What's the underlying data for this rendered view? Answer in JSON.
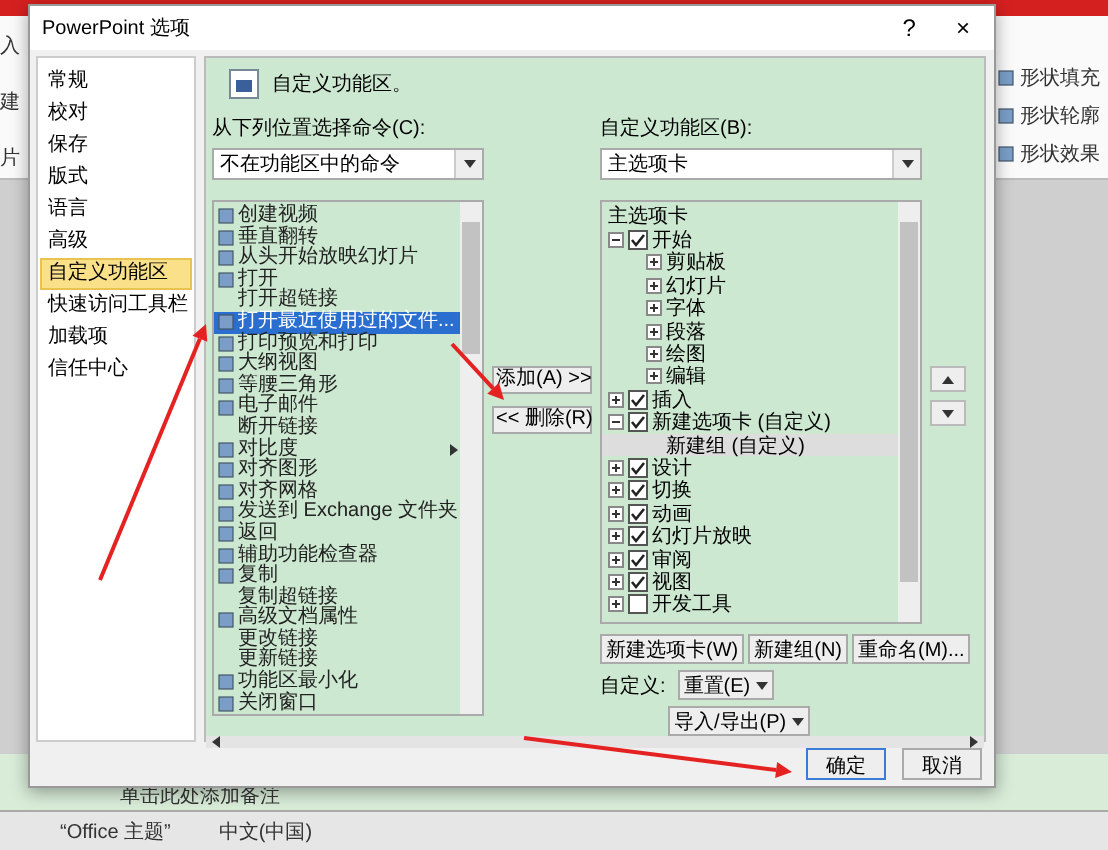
{
  "app": {
    "ribbon_left": [
      "入",
      "建",
      "片"
    ],
    "ribbon_right": [
      "形状填充",
      "形状轮廓",
      "形状效果"
    ],
    "notes": "单击此处添加备注",
    "status": [
      "“Office 主题”",
      "中文(中国)"
    ]
  },
  "dialog": {
    "title": "PowerPoint 选项",
    "help": "?",
    "close": "×",
    "nav": [
      {
        "label": "常规",
        "selected": false
      },
      {
        "label": "校对",
        "selected": false
      },
      {
        "label": "保存",
        "selected": false
      },
      {
        "label": "版式",
        "selected": false
      },
      {
        "label": "语言",
        "selected": false
      },
      {
        "label": "高级",
        "selected": false
      },
      {
        "label": "自定义功能区",
        "selected": true
      },
      {
        "label": "快速访问工具栏",
        "selected": false
      },
      {
        "label": "加载项",
        "selected": false
      },
      {
        "label": "信任中心",
        "selected": false
      }
    ],
    "heading": "自定义功能区。",
    "source_label": "从下列位置选择命令(C):",
    "source_value": "不在功能区中的命令",
    "target_label": "自定义功能区(B):",
    "target_value": "主选项卡",
    "commands": [
      {
        "label": "创建视频",
        "selected": false,
        "has_icon": true,
        "submenu": false
      },
      {
        "label": "垂直翻转",
        "selected": false,
        "has_icon": true,
        "submenu": false
      },
      {
        "label": "从头开始放映幻灯片",
        "selected": false,
        "has_icon": true,
        "submenu": false
      },
      {
        "label": "打开",
        "selected": false,
        "has_icon": true,
        "submenu": false
      },
      {
        "label": "打开超链接",
        "selected": false,
        "has_icon": false,
        "submenu": false
      },
      {
        "label": "打开最近使用过的文件...",
        "selected": true,
        "has_icon": true,
        "submenu": false
      },
      {
        "label": "打印预览和打印",
        "selected": false,
        "has_icon": true,
        "submenu": false
      },
      {
        "label": "大纲视图",
        "selected": false,
        "has_icon": true,
        "submenu": false
      },
      {
        "label": "等腰三角形",
        "selected": false,
        "has_icon": true,
        "submenu": false
      },
      {
        "label": "电子邮件",
        "selected": false,
        "has_icon": true,
        "submenu": false
      },
      {
        "label": "断开链接",
        "selected": false,
        "has_icon": false,
        "submenu": false
      },
      {
        "label": "对比度",
        "selected": false,
        "has_icon": true,
        "submenu": true
      },
      {
        "label": "对齐图形",
        "selected": false,
        "has_icon": true,
        "submenu": false
      },
      {
        "label": "对齐网格",
        "selected": false,
        "has_icon": true,
        "submenu": false
      },
      {
        "label": "发送到 Exchange 文件夹",
        "selected": false,
        "has_icon": true,
        "submenu": false
      },
      {
        "label": "返回",
        "selected": false,
        "has_icon": true,
        "submenu": false
      },
      {
        "label": "辅助功能检查器",
        "selected": false,
        "has_icon": true,
        "submenu": false
      },
      {
        "label": "复制",
        "selected": false,
        "has_icon": true,
        "submenu": false
      },
      {
        "label": "复制超链接",
        "selected": false,
        "has_icon": false,
        "submenu": false
      },
      {
        "label": "高级文档属性",
        "selected": false,
        "has_icon": true,
        "submenu": false
      },
      {
        "label": "更改链接",
        "selected": false,
        "has_icon": false,
        "submenu": false
      },
      {
        "label": "更新链接",
        "selected": false,
        "has_icon": false,
        "submenu": false
      },
      {
        "label": "功能区最小化",
        "selected": false,
        "has_icon": true,
        "submenu": false
      },
      {
        "label": "关闭窗口",
        "selected": false,
        "has_icon": true,
        "submenu": false
      }
    ],
    "add_button": "添加(A) >>",
    "remove_button": "<< 删除(R)",
    "tree_header": "主选项卡",
    "tree": [
      {
        "kind": "tab",
        "label": "开始",
        "checked": true,
        "expanded": true,
        "selected": false,
        "children": [
          {
            "kind": "group",
            "label": "剪贴板",
            "selected": false
          },
          {
            "kind": "group",
            "label": "幻灯片",
            "selected": false
          },
          {
            "kind": "group",
            "label": "字体",
            "selected": false
          },
          {
            "kind": "group",
            "label": "段落",
            "selected": false
          },
          {
            "kind": "group",
            "label": "绘图",
            "selected": false
          },
          {
            "kind": "group",
            "label": "编辑",
            "selected": false
          }
        ]
      },
      {
        "kind": "tab",
        "label": "插入",
        "checked": true,
        "expanded": false,
        "selected": false
      },
      {
        "kind": "tab",
        "label": "新建选项卡 (自定义)",
        "checked": true,
        "expanded": true,
        "selected": false,
        "children": [
          {
            "kind": "empty-group",
            "label": "新建组 (自定义)",
            "selected": true
          }
        ]
      },
      {
        "kind": "tab",
        "label": "设计",
        "checked": true,
        "expanded": false,
        "selected": false
      },
      {
        "kind": "tab",
        "label": "切换",
        "checked": true,
        "expanded": false,
        "selected": false
      },
      {
        "kind": "tab",
        "label": "动画",
        "checked": true,
        "expanded": false,
        "selected": false
      },
      {
        "kind": "tab",
        "label": "幻灯片放映",
        "checked": true,
        "expanded": false,
        "selected": false
      },
      {
        "kind": "tab",
        "label": "审阅",
        "checked": true,
        "expanded": false,
        "selected": false
      },
      {
        "kind": "tab",
        "label": "视图",
        "checked": true,
        "expanded": false,
        "selected": false
      },
      {
        "kind": "tab",
        "label": "开发工具",
        "checked": false,
        "expanded": false,
        "selected": false
      }
    ],
    "tree_buttons": [
      "新建选项卡(W)",
      "新建组(N)",
      "重命名(M)..."
    ],
    "customize_label": "自定义:",
    "reset_button": "重置(E)",
    "import_button": "导入/导出(P)",
    "ok": "确定",
    "cancel": "取消"
  }
}
